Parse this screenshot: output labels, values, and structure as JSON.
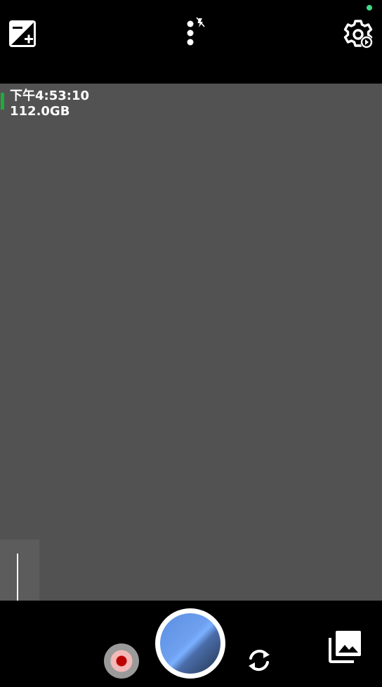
{
  "status": {
    "time": "下午4:53:10",
    "storage": "112.0GB",
    "indicator_color": "#3ddc84",
    "battery_color": "#1faa3a"
  },
  "toolbar": {
    "exposure_icon": "exposure-plus-minus-icon",
    "more_icon": "more-vertical-flash-off-icon",
    "settings_icon": "settings-gear-icon"
  },
  "controls": {
    "record_icon": "record-icon",
    "shutter_icon": "shutter-button",
    "switch_camera_icon": "switch-camera-icon",
    "gallery_icon": "gallery-icon",
    "zoom_level": 0
  },
  "colors": {
    "preview_bg": "#525252",
    "bars_bg": "#000000",
    "shutter_blue": "#6fa0f0"
  }
}
